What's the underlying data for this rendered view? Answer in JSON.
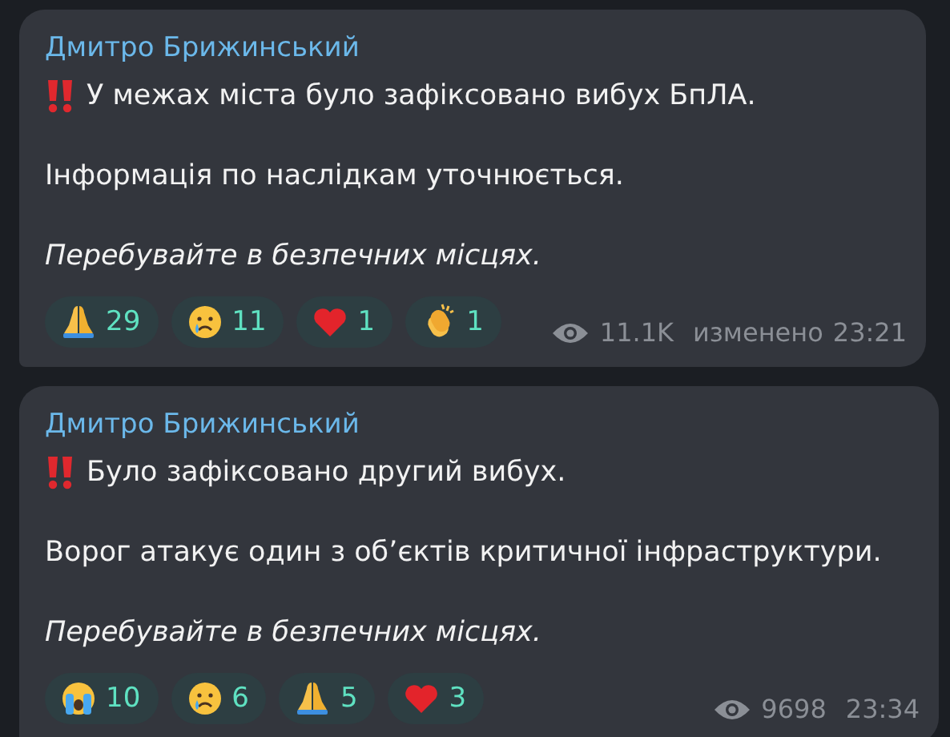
{
  "messages": [
    {
      "author": "Дмитро Брижинський",
      "lines": [
        {
          "kind": "alert",
          "text": "У межах міста було зафіксовано вибух БпЛА."
        },
        {
          "kind": "plain",
          "text": "Інформація по наслідкам уточнюється."
        },
        {
          "kind": "italic",
          "text": "Перебувайте в безпечних місцях."
        }
      ],
      "reactions": [
        {
          "kind": "pray",
          "count": "29"
        },
        {
          "kind": "cry",
          "count": "11"
        },
        {
          "kind": "heart",
          "count": "1"
        },
        {
          "kind": "clap",
          "count": "1"
        }
      ],
      "views": "11.1K",
      "edited": "изменено",
      "time": "23:21"
    },
    {
      "author": "Дмитро Брижинський",
      "lines": [
        {
          "kind": "alert",
          "text": "Було зафіксовано другий вибух."
        },
        {
          "kind": "plain",
          "text": "Ворог атакує один з обʼєктів критичної інфраструктури."
        },
        {
          "kind": "italic",
          "text": "Перебувайте в безпечних місцях."
        }
      ],
      "reactions": [
        {
          "kind": "sob",
          "count": "10"
        },
        {
          "kind": "cry",
          "count": "6"
        },
        {
          "kind": "pray",
          "count": "5"
        },
        {
          "kind": "heart",
          "count": "3"
        }
      ],
      "views": "9698",
      "time": "23:34"
    }
  ]
}
